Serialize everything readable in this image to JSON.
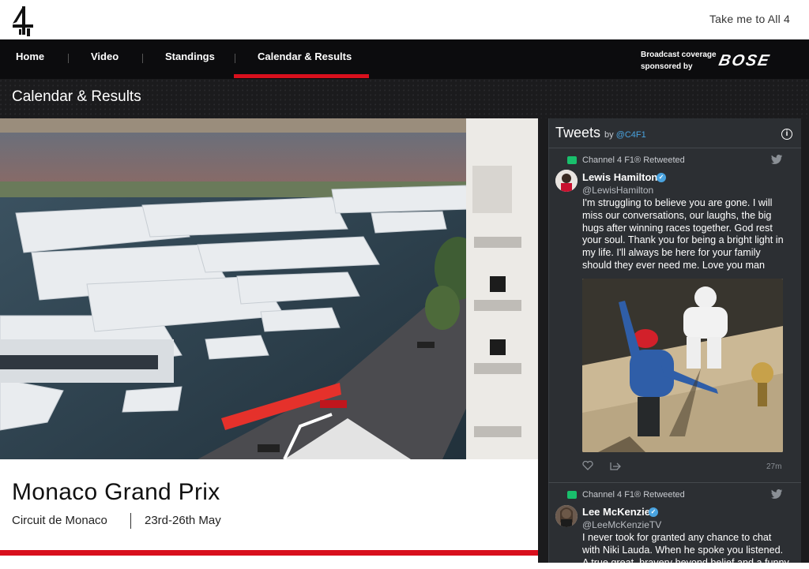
{
  "header": {
    "all4_link": "Take me to All 4"
  },
  "nav": {
    "items": [
      "Home",
      "Video",
      "Standings",
      "Calendar & Results"
    ],
    "active": "Calendar & Results",
    "sponsor_line1": "Broadcast coverage",
    "sponsor_line2": "sponsored by",
    "sponsor_brand": "BOSE"
  },
  "section": {
    "title": "Calendar & Results"
  },
  "event": {
    "title": "Monaco Grand Prix",
    "circuit": "Circuit de Monaco",
    "dates": "23rd-26th May"
  },
  "tweets": {
    "title": "Tweets",
    "by_prefix": "by",
    "by_handle": "@C4F1",
    "items": [
      {
        "retweeted_by": "Channel 4 F1® Retweeted",
        "name": "Lewis Hamilton",
        "handle": "@LewisHamilton",
        "text": "I'm struggling to believe you are gone. I will miss our conversations, our laughs, the big hugs after winning races together. God rest your soul. Thank you for being a bright light in my life. I'll always be here for your family should they ever need me. Love you man",
        "time": "27m"
      },
      {
        "retweeted_by": "Channel 4 F1® Retweeted",
        "name": "Lee McKenzie",
        "handle": "@LeeMcKenzieTV",
        "text": "I never took for granted any chance to chat with Niki Lauda. When he spoke you listened. A true great, bravery beyond belief and a funny"
      }
    ]
  },
  "colors": {
    "accent_red": "#d8101d",
    "nav_bg": "#0c0c0e",
    "tweet_panel": "#2c2f33",
    "twitter_blue": "#4aa3df",
    "retweet_green": "#19bf6c"
  }
}
